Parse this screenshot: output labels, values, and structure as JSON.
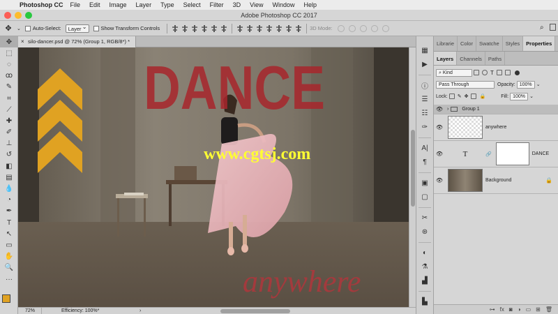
{
  "menubar": {
    "app_name": "Photoshop CC",
    "items": [
      "File",
      "Edit",
      "Image",
      "Layer",
      "Type",
      "Select",
      "Filter",
      "3D",
      "View",
      "Window",
      "Help"
    ]
  },
  "window": {
    "title": "Adobe Photoshop CC 2017"
  },
  "options": {
    "auto_select_label": "Auto-Select:",
    "auto_select_value": "Layer",
    "show_transform_label": "Show Transform Controls",
    "mode_3d_label": "3D Mode:"
  },
  "document": {
    "tab_label": "silo-dancer.psd @ 72% (Group 1, RGB/8*) *",
    "tab_close": "×"
  },
  "canvas": {
    "title_text": "DANCE",
    "script_text": "anywhere",
    "watermark": "www.cgtsj.com"
  },
  "status": {
    "zoom": "72%",
    "efficiency": "Efficiency: 100%*",
    "arrow": "›"
  },
  "panels": {
    "top_tabs": [
      "Librarie",
      "Color",
      "Swatche",
      "Styles",
      "Properties"
    ],
    "layer_tabs": [
      "Layers",
      "Channels",
      "Paths"
    ],
    "filter_kind": "Kind",
    "blend_mode": "Pass Through",
    "opacity_label": "Opacity:",
    "opacity_value": "100%",
    "lock_label": "Lock:",
    "fill_label": "Fill:",
    "fill_value": "100%",
    "layers": [
      {
        "name": "Group 1"
      },
      {
        "name": "anywhere"
      },
      {
        "name": "DANCE"
      },
      {
        "name": "Background"
      }
    ]
  },
  "colors": {
    "accent_orange": "#e0a222",
    "dance_red": "#a8262c",
    "selected_layer": "#bcbcbc"
  }
}
